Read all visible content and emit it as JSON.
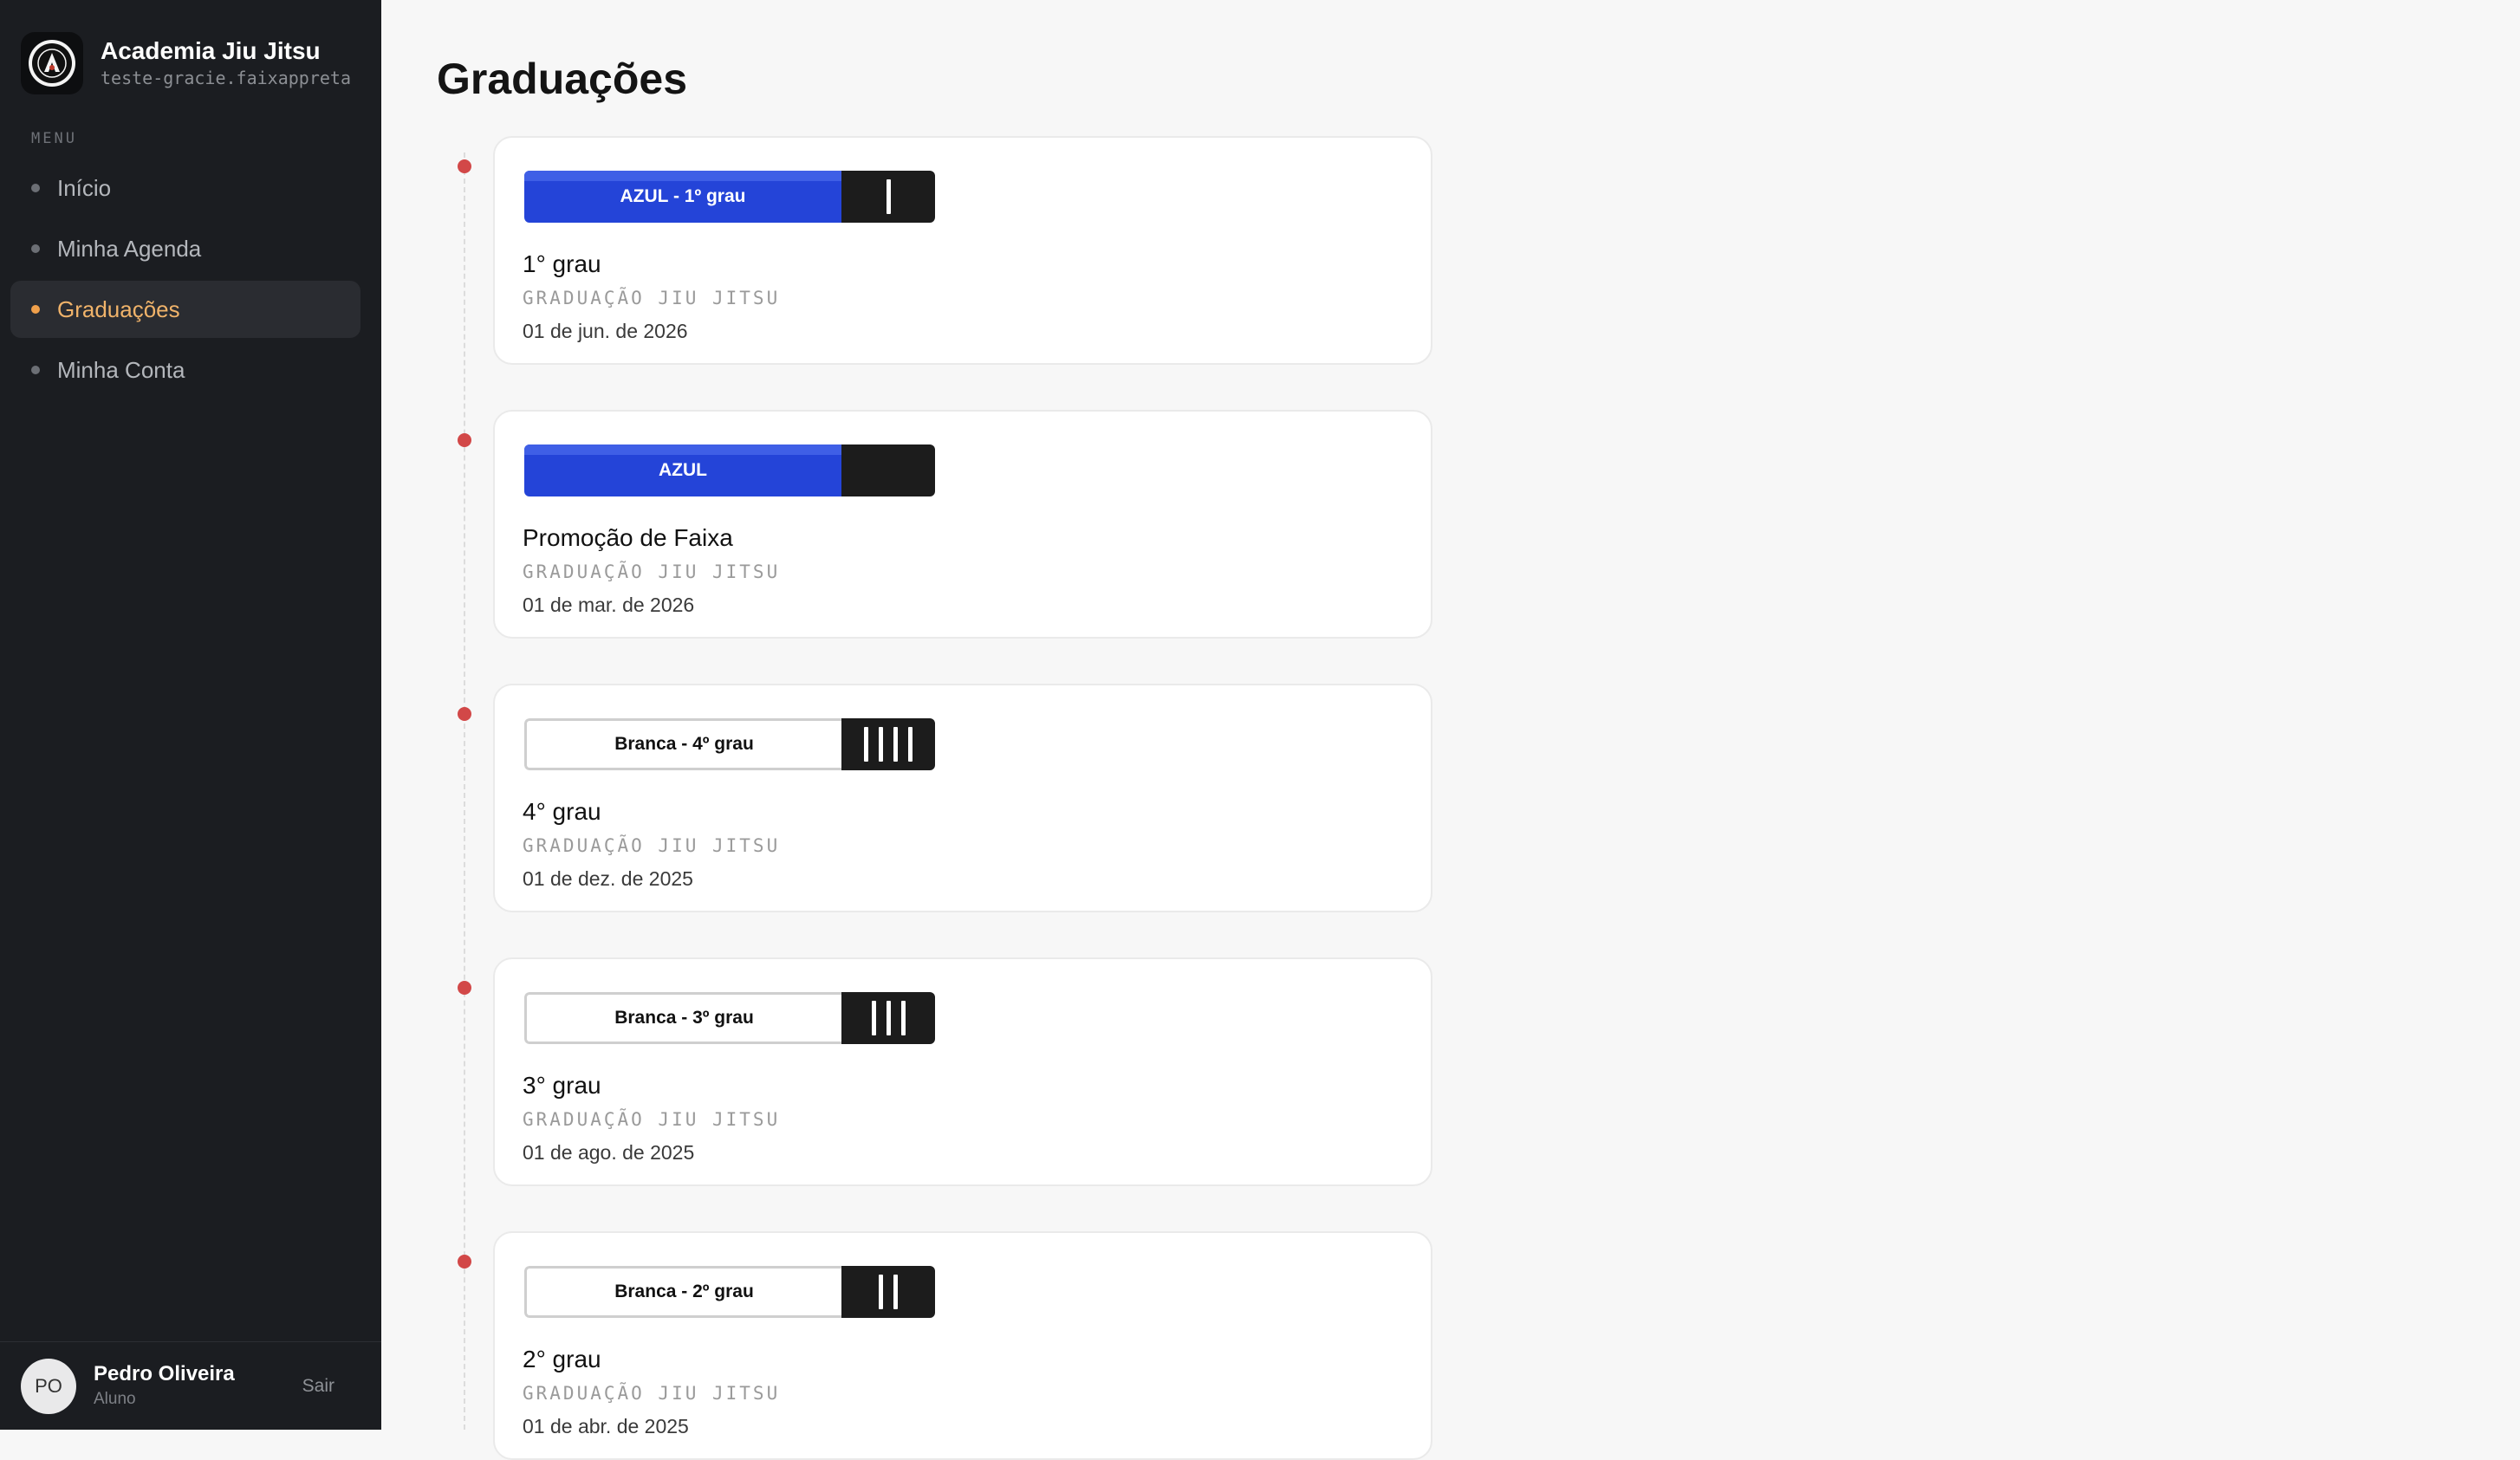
{
  "sidebar": {
    "brand_name": "Academia Jiu Jitsu",
    "brand_domain": "teste-gracie.faixappreta",
    "menu_label": "MENU",
    "items": [
      {
        "label": "Início",
        "active": false
      },
      {
        "label": "Minha Agenda",
        "active": false
      },
      {
        "label": "Graduações",
        "active": true
      },
      {
        "label": "Minha Conta",
        "active": false
      }
    ],
    "user": {
      "initials": "PO",
      "name": "Pedro Oliveira",
      "role": "Aluno",
      "logout_label": "Sair"
    }
  },
  "main": {
    "title": "Graduações",
    "graduations": [
      {
        "belt_label": "AZUL - 1º grau",
        "belt_color": "blue",
        "stripes": 1,
        "title": "1° grau",
        "category": "GRADUAÇÃO JIU JITSU",
        "date": "01 de jun. de 2026"
      },
      {
        "belt_label": "AZUL",
        "belt_color": "blue",
        "stripes": 0,
        "title": "Promoção de Faixa",
        "category": "GRADUAÇÃO JIU JITSU",
        "date": "01 de mar. de 2026"
      },
      {
        "belt_label": "Branca - 4º grau",
        "belt_color": "white",
        "stripes": 4,
        "title": "4° grau",
        "category": "GRADUAÇÃO JIU JITSU",
        "date": "01 de dez. de 2025"
      },
      {
        "belt_label": "Branca - 3º grau",
        "belt_color": "white",
        "stripes": 3,
        "title": "3° grau",
        "category": "GRADUAÇÃO JIU JITSU",
        "date": "01 de ago. de 2025"
      },
      {
        "belt_label": "Branca - 2º grau",
        "belt_color": "white",
        "stripes": 2,
        "title": "2° grau",
        "category": "GRADUAÇÃO JIU JITSU",
        "date": "01 de abr. de 2025"
      }
    ]
  },
  "colors": {
    "sidebar_bg": "#1b1d21",
    "accent_active": "#f0a04b",
    "timeline_dot": "#d24848",
    "belt_blue": "#2444d8",
    "belt_tip": "#1c1c1c"
  }
}
